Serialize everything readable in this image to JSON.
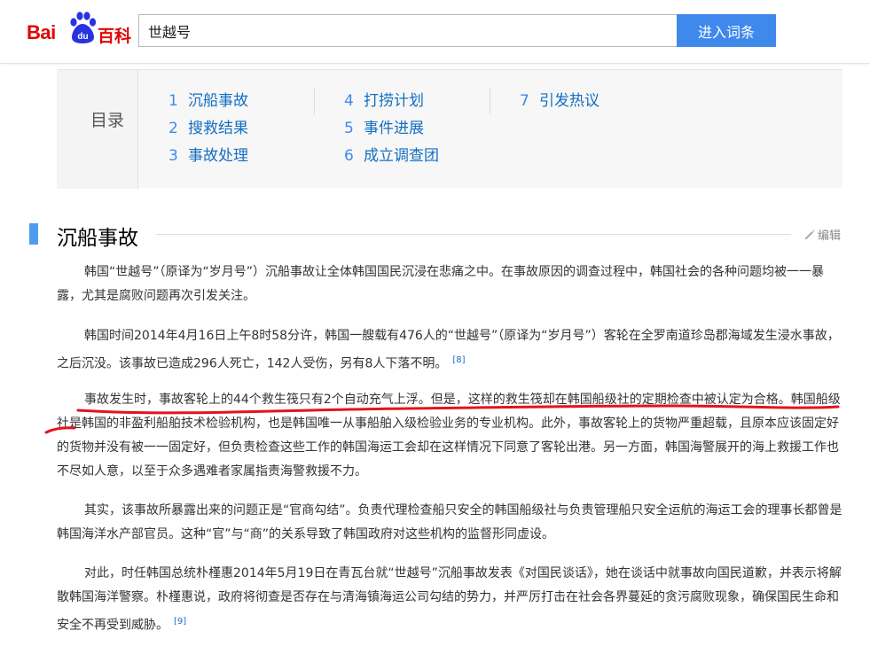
{
  "header": {
    "logo_text_bai": "Bai",
    "logo_text_du": "du",
    "logo_text_baike": "百科",
    "search_value": "世越号",
    "search_button": "进入词条"
  },
  "catalog": {
    "title": "目录",
    "columns": [
      [
        {
          "num": "1",
          "label": "沉船事故"
        },
        {
          "num": "2",
          "label": "搜救结果"
        },
        {
          "num": "3",
          "label": "事故处理"
        }
      ],
      [
        {
          "num": "4",
          "label": "打捞计划"
        },
        {
          "num": "5",
          "label": "事件进展"
        },
        {
          "num": "6",
          "label": "成立调查团"
        }
      ],
      [
        {
          "num": "7",
          "label": "引发热议"
        }
      ]
    ]
  },
  "section": {
    "title": "沉船事故",
    "edit_label": "编辑"
  },
  "paragraphs": [
    {
      "text": "韩国“世越号”（原译为“岁月号”）沉船事故让全体韩国国民沉浸在悲痛之中。在事故原因的调查过程中，韩国社会的各种问题均被一一暴露，尤其是腐败问题再次引发关注。",
      "ref": ""
    },
    {
      "text": "韩国时间2014年4月16日上午8时58分许，韩国一艘载有476人的“世越号”（原译为“岁月号”）客轮在全罗南道珍岛郡海域发生浸水事故，之后沉没。该事故已造成296人死亡，142人受伤，另有8人下落不明。",
      "ref": "[8]"
    },
    {
      "text": "事故发生时，事故客轮上的44个救生筏只有2个自动充气上浮。但是，这样的救生筏却在韩国船级社的定期检查中被认定为合格。韩国船级社是韩国的非盈利船舶技术检验机构，也是韩国唯一从事船舶入级检验业务的专业机构。此外，事故客轮上的货物严重超载，且原本应该固定好的货物并没有被一一固定好，但负责检查这些工作的韩国海运工会却在这样情况下同意了客轮出港。另一方面，韩国海警展开的海上救援工作也不尽如人意，以至于众多遇难者家属指责海警救援不力。",
      "ref": ""
    },
    {
      "text": "其实，该事故所暴露出来的问题正是“官商勾结”。负责代理检查船只安全的韩国船级社与负责管理船只安全运航的海运工会的理事长都曾是韩国海洋水产部官员。这种“官”与“商”的关系导致了韩国政府对这些机构的监督形同虚设。",
      "ref": ""
    },
    {
      "text": "对此，时任韩国总统朴槿惠2014年5月19日在青瓦台就“世越号”沉船事故发表《对国民谈话》，她在谈话中就事故向国民道歉，并表示将解散韩国海洋警察。朴槿惠说，政府将彻查是否存在与清海镇海运公司勾结的势力，并严厉打击在社会各界蔓延的贪污腐败现象，确保国民生命和安全不再受到威胁。",
      "ref": "[9]"
    }
  ],
  "colors": {
    "brand_red": "#e10602",
    "brand_blue": "#3f89ec",
    "link_blue": "#136ec2",
    "annotation_red": "#e3141b"
  }
}
